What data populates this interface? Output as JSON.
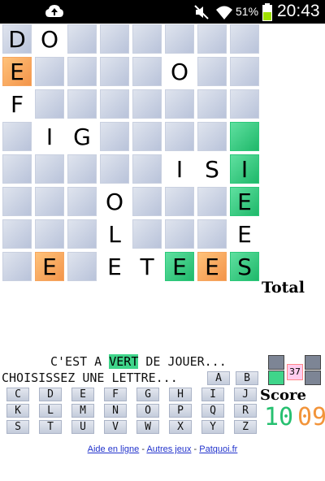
{
  "status": {
    "battery": "51%",
    "time": "20:43"
  },
  "board": {
    "size": 8,
    "cells": [
      {
        "r": 0,
        "c": 0,
        "l": "D",
        "k": "normal"
      },
      {
        "r": 0,
        "c": 1,
        "l": "O",
        "k": "blank"
      },
      {
        "r": 1,
        "c": 0,
        "l": "E",
        "k": "orange"
      },
      {
        "r": 1,
        "c": 5,
        "l": "O",
        "k": "blank"
      },
      {
        "r": 2,
        "c": 0,
        "l": "F",
        "k": "blank"
      },
      {
        "r": 3,
        "c": 1,
        "l": "I",
        "k": "blank"
      },
      {
        "r": 3,
        "c": 2,
        "l": "G",
        "k": "blank"
      },
      {
        "r": 3,
        "c": 7,
        "l": "",
        "k": "green"
      },
      {
        "r": 4,
        "c": 5,
        "l": "I",
        "k": "blank"
      },
      {
        "r": 4,
        "c": 6,
        "l": "S",
        "k": "blank"
      },
      {
        "r": 4,
        "c": 7,
        "l": "I",
        "k": "green"
      },
      {
        "r": 5,
        "c": 3,
        "l": "O",
        "k": "blank"
      },
      {
        "r": 5,
        "c": 7,
        "l": "E",
        "k": "green"
      },
      {
        "r": 6,
        "c": 3,
        "l": "L",
        "k": "blank"
      },
      {
        "r": 6,
        "c": 7,
        "l": "E",
        "k": "blank"
      },
      {
        "r": 7,
        "c": 1,
        "l": "E",
        "k": "orange"
      },
      {
        "r": 7,
        "c": 3,
        "l": "E",
        "k": "blank"
      },
      {
        "r": 7,
        "c": 4,
        "l": "T",
        "k": "blank"
      },
      {
        "r": 7,
        "c": 5,
        "l": "E",
        "k": "green"
      },
      {
        "r": 7,
        "c": 6,
        "l": "E",
        "k": "orange"
      },
      {
        "r": 7,
        "c": 7,
        "l": "S",
        "k": "green"
      }
    ]
  },
  "labels": {
    "total": "Total",
    "msg1_pre": "C'EST A ",
    "msg1_hl": "VERT",
    "msg1_post": " DE JOUER...",
    "msg2": "CHOISISSEZ UNE LETTRE...",
    "score": "Score",
    "score_green": "10",
    "score_orange": "09",
    "letters_left": "37"
  },
  "keys": [
    "A",
    "B",
    "C",
    "D",
    "E",
    "F",
    "G",
    "H",
    "I",
    "J",
    "K",
    "L",
    "M",
    "N",
    "O",
    "P",
    "Q",
    "R",
    "S",
    "T",
    "U",
    "V",
    "W",
    "X",
    "Y",
    "Z"
  ],
  "footer": {
    "l1": "Aide en ligne",
    "sep": " - ",
    "l2": "Autres jeux",
    "l3": "Patquoi.fr"
  }
}
